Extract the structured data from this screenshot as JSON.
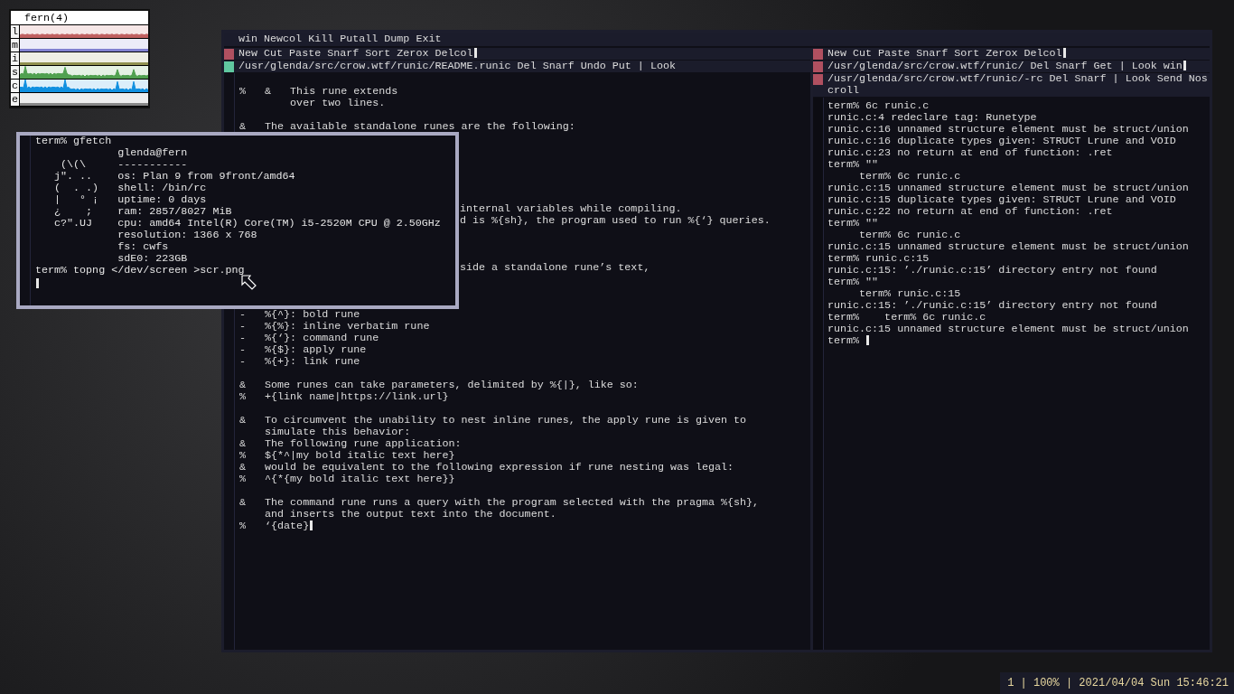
{
  "stats_window": {
    "title": "fern(4)",
    "rows": [
      {
        "label": "l",
        "color": "#c06060"
      },
      {
        "label": "m",
        "color": "#8080d0"
      },
      {
        "label": "i",
        "color": "#909050"
      },
      {
        "label": "s",
        "color": "#50a050"
      },
      {
        "label": "c",
        "color": "#1090e0"
      },
      {
        "label": "e",
        "color": "#888888"
      }
    ]
  },
  "acme": {
    "tag": "win Newcol Kill Putall Dump Exit",
    "columns": [
      {
        "tags": [
          {
            "text": "New Cut Paste Snarf Sort Zerox Delcol",
            "color": "#b05060",
            "cursor": true
          },
          {
            "text": "/usr/glenda/src/crow.wtf/runic/README.runic Del Snarf Undo Put | Look",
            "color": "#60c8a0",
            "cursor": false
          }
        ],
        "cursor_at_end": true,
        "lines": [
          {
            "kind": "text",
            "text": "%   &   This rune extends"
          },
          {
            "kind": "text",
            "text": "        over two lines."
          },
          {
            "kind": "blank"
          },
          {
            "kind": "text",
            "text": "&   The available standalone runes are the following:"
          },
          {
            "kind": "blank"
          },
          {
            "kind": "blank"
          },
          {
            "kind": "blank"
          },
          {
            "kind": "blank"
          },
          {
            "kind": "blank"
          },
          {
            "kind": "blank"
          },
          {
            "kind": "covered",
            "text": "internal variables while compiling."
          },
          {
            "kind": "covered",
            "text": "d is %{sh}, the program used to run %{‘} queries."
          },
          {
            "kind": "blank"
          },
          {
            "kind": "blank"
          },
          {
            "kind": "blank"
          },
          {
            "kind": "covered",
            "text": "side a standalone rune’s text,"
          },
          {
            "kind": "blank"
          },
          {
            "kind": "blank"
          },
          {
            "kind": "blank"
          },
          {
            "kind": "text",
            "text": "-   %{^}: bold rune"
          },
          {
            "kind": "text",
            "text": "-   %{%}: inline verbatim rune"
          },
          {
            "kind": "text",
            "text": "-   %{‘}: command rune"
          },
          {
            "kind": "text",
            "text": "-   %{$}: apply rune"
          },
          {
            "kind": "text",
            "text": "-   %{+}: link rune"
          },
          {
            "kind": "blank"
          },
          {
            "kind": "text",
            "text": "&   Some runes can take parameters, delimited by %{|}, like so:"
          },
          {
            "kind": "text",
            "text": "%   +{link name|https://link.url}"
          },
          {
            "kind": "blank"
          },
          {
            "kind": "text",
            "text": "&   To circumvent the unability to nest inline runes, the apply rune is given to"
          },
          {
            "kind": "text",
            "text": "    simulate this behavior:"
          },
          {
            "kind": "text",
            "text": "&   The following rune application:"
          },
          {
            "kind": "text",
            "text": "%   ${*^|my bold italic text here}"
          },
          {
            "kind": "text",
            "text": "&   would be equivalent to the following expression if rune nesting was legal:"
          },
          {
            "kind": "text",
            "text": "%   ^{*{my bold italic text here}}"
          },
          {
            "kind": "blank"
          },
          {
            "kind": "text",
            "text": "&   The command rune runs a query with the program selected with the pragma %{sh},"
          },
          {
            "kind": "text",
            "text": "    and inserts the output text into the document."
          },
          {
            "kind": "text",
            "text": "%   ‘{date}"
          }
        ]
      },
      {
        "tags": [
          {
            "text": "New Cut Paste Snarf Sort Zerox Delcol",
            "color": "#b05060",
            "cursor": true
          },
          {
            "text": "/usr/glenda/src/crow.wtf/runic/ Del Snarf Get | Look win",
            "color": "#b05060",
            "cursor": true
          },
          {
            "text": "/usr/glenda/src/crow.wtf/runic/-rc Del Snarf | Look Send Noscroll",
            "color": "#b05060",
            "cursor": false
          }
        ],
        "cursor_at_end": true,
        "lines": [
          {
            "kind": "text",
            "text": "term% 6c runic.c"
          },
          {
            "kind": "text",
            "text": "runic.c:4 redeclare tag: Runetype"
          },
          {
            "kind": "text",
            "text": "runic.c:16 unnamed structure element must be struct/union"
          },
          {
            "kind": "text",
            "text": "runic.c:16 duplicate types given: STRUCT Lrune and VOID"
          },
          {
            "kind": "text",
            "text": "runic.c:23 no return at end of function: .ret"
          },
          {
            "kind": "text",
            "text": "term% \"\""
          },
          {
            "kind": "text",
            "text": "     term% 6c runic.c"
          },
          {
            "kind": "text",
            "text": "runic.c:15 unnamed structure element must be struct/union"
          },
          {
            "kind": "text",
            "text": "runic.c:15 duplicate types given: STRUCT Lrune and VOID"
          },
          {
            "kind": "text",
            "text": "runic.c:22 no return at end of function: .ret"
          },
          {
            "kind": "text",
            "text": "term% \"\""
          },
          {
            "kind": "text",
            "text": "     term% 6c runic.c"
          },
          {
            "kind": "text",
            "text": "runic.c:15 unnamed structure element must be struct/union"
          },
          {
            "kind": "text",
            "text": "term% runic.c:15"
          },
          {
            "kind": "text",
            "text": "runic.c:15: ’./runic.c:15’ directory entry not found"
          },
          {
            "kind": "text",
            "text": "term% \"\""
          },
          {
            "kind": "text",
            "text": "     term% runic.c:15"
          },
          {
            "kind": "text",
            "text": "runic.c:15: ’./runic.c:15’ directory entry not found"
          },
          {
            "kind": "text",
            "text": "term%    term% 6c runic.c"
          },
          {
            "kind": "text",
            "text": "runic.c:15 unnamed structure element must be struct/union"
          },
          {
            "kind": "text",
            "text": "term% "
          }
        ]
      }
    ]
  },
  "terminal": {
    "lines": [
      {
        "kind": "prompt",
        "text": "term% gfetch"
      },
      {
        "kind": "fetch",
        "info": "glenda@fern"
      },
      {
        "kind": "fetch",
        "art": "    (\\(\\",
        "info": "-----------"
      },
      {
        "kind": "fetch",
        "art": "   j\". ..",
        "info": "os: Plan 9 from 9front/amd64"
      },
      {
        "kind": "fetch",
        "art": "   (  . .)",
        "info": "shell: /bin/rc"
      },
      {
        "kind": "fetch",
        "art": "   |   ° ¡",
        "info": "uptime: 0 days"
      },
      {
        "kind": "fetch",
        "art": "   ¿    ;",
        "info": "ram: 2857/8027 MiB"
      },
      {
        "kind": "fetch",
        "art": "   c?\".UJ",
        "info": "cpu: amd64 Intel(R) Core(TM) i5-2520M CPU @ 2.50GHz"
      },
      {
        "kind": "fetch",
        "info": "resolution: 1366 x 768"
      },
      {
        "kind": "fetch",
        "info": "fs: cwfs"
      },
      {
        "kind": "fetch",
        "info": "sdE0: 223GB"
      },
      {
        "kind": "prompt",
        "text": "term% topng </dev/screen >scr.png"
      }
    ],
    "cursor_at_end": true
  },
  "status_bar": {
    "text": "1 | 100% | 2021/04/04 Sun 15:46:21"
  }
}
